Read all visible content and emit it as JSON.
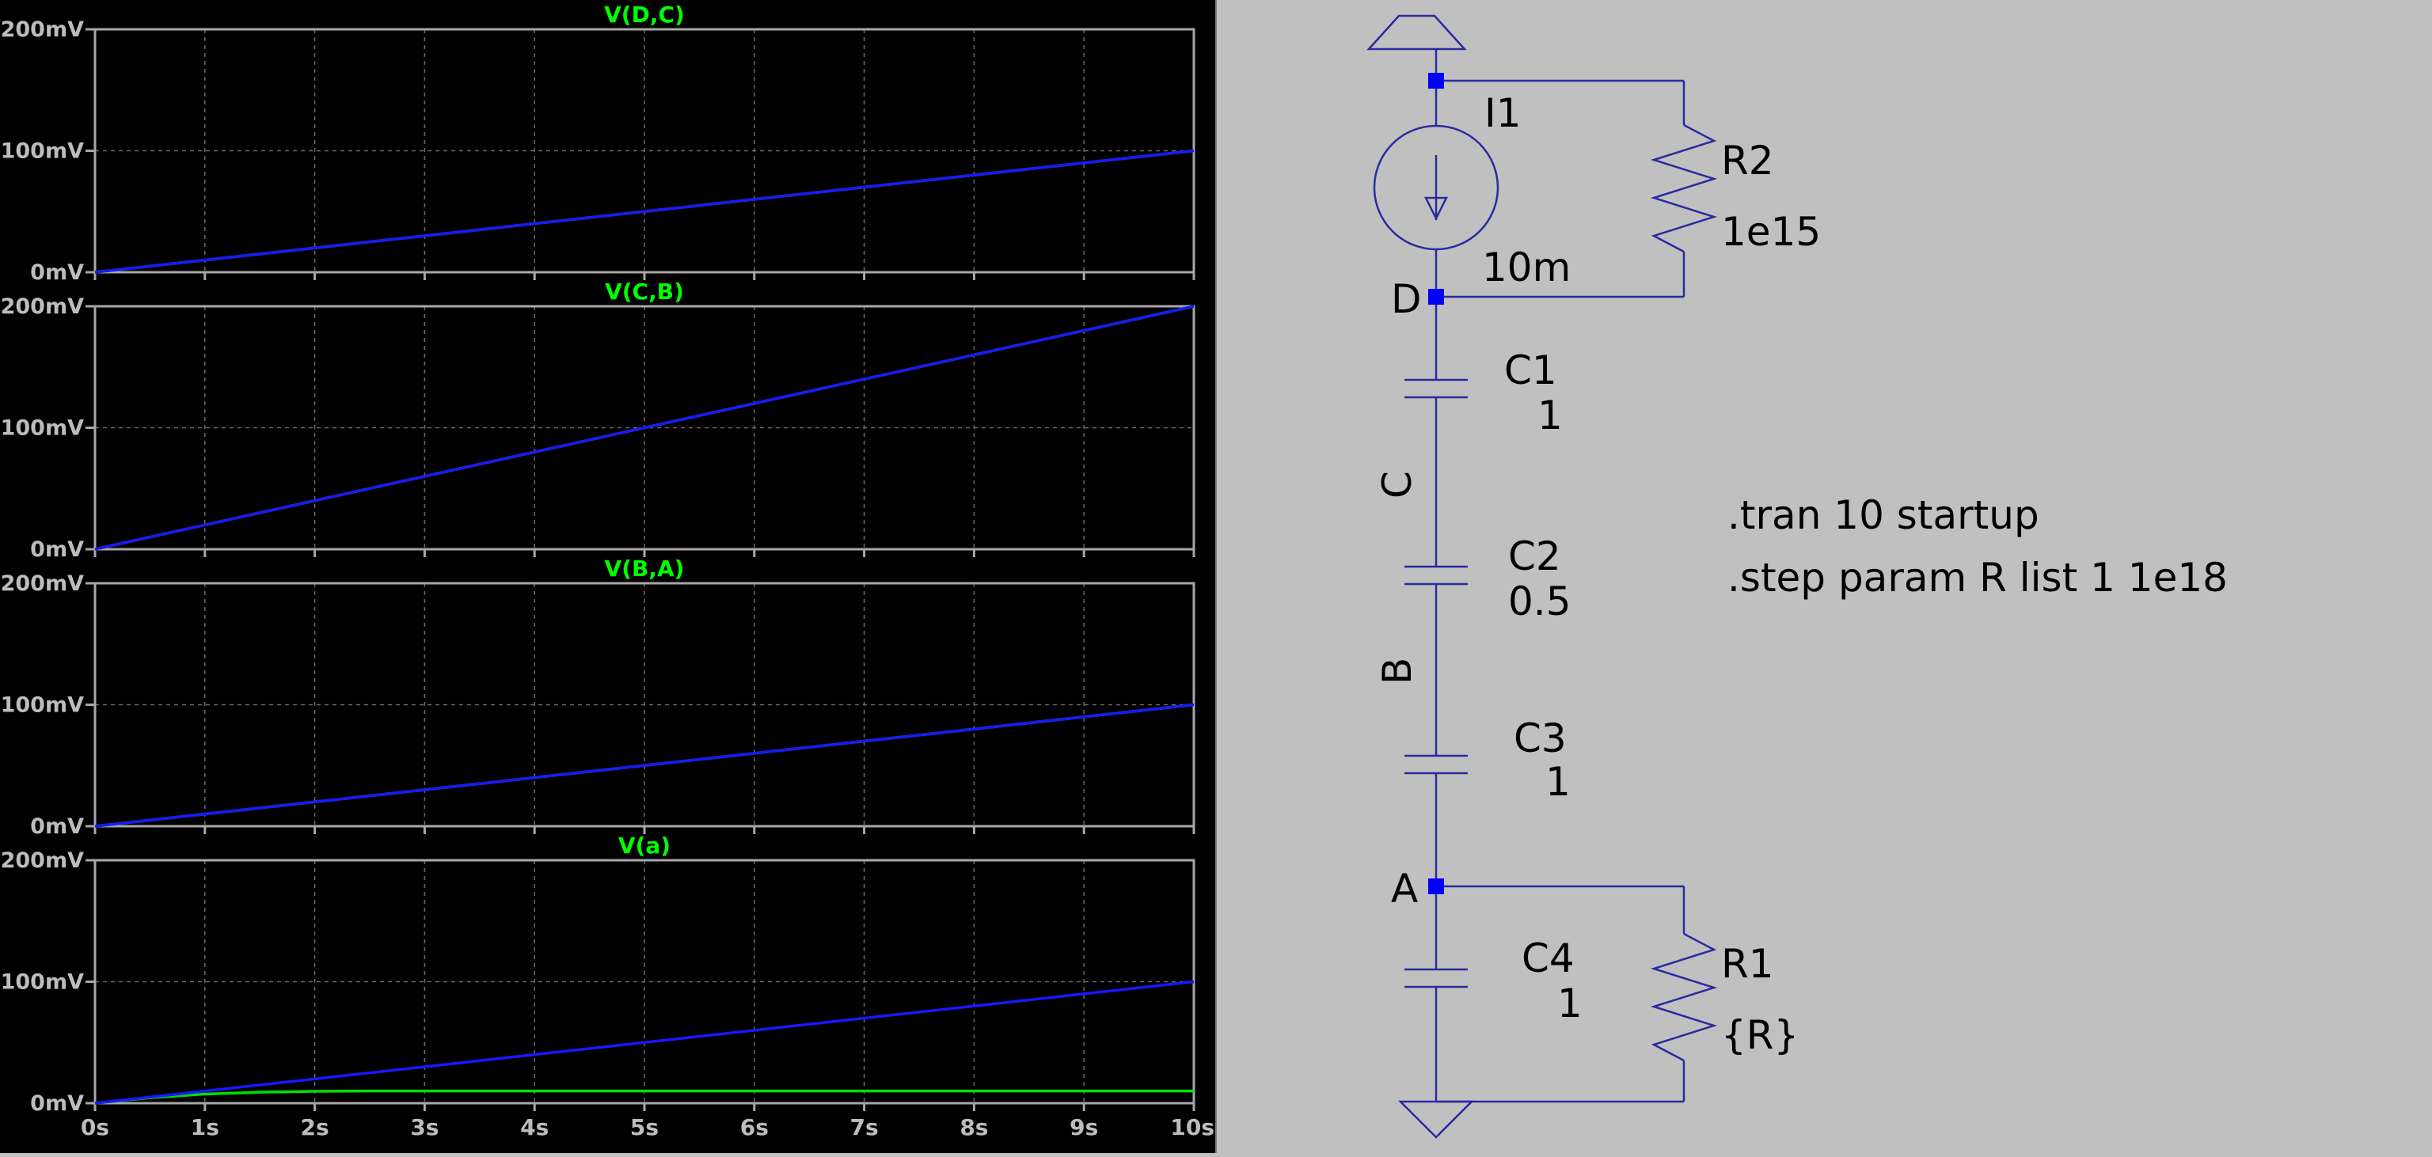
{
  "colors": {
    "plot_background": "#000000",
    "plot_frame": "#a8a8a8",
    "grid": "#6a6a6a",
    "axis_text": "#bdbdbd",
    "trace_title": "#00ff00",
    "trace_blue": "#1818ff",
    "trace_green": "#00e000",
    "schematic_background": "#c0c0c0",
    "schematic_wire": "#2a2aa0",
    "schematic_node": "#0000ff",
    "schematic_text": "#000000"
  },
  "plot": {
    "x_tick_labels": [
      "0s",
      "1s",
      "2s",
      "3s",
      "4s",
      "5s",
      "6s",
      "7s",
      "8s",
      "9s",
      "10s"
    ],
    "y_tick_labels": [
      "0mV",
      "100mV",
      "200mV"
    ]
  },
  "chart_data": [
    {
      "type": "line",
      "title": "V(D,C)",
      "xlabel": "",
      "ylabel": "",
      "xlim": [
        0,
        10
      ],
      "ylim": [
        0,
        200
      ],
      "grid": true,
      "series": [
        {
          "color": "#1818ff",
          "x": [
            0,
            10
          ],
          "y": [
            0,
            100
          ]
        },
        {
          "color": "#00e000",
          "x": [
            0,
            10
          ],
          "y": [
            0,
            100
          ]
        }
      ]
    },
    {
      "type": "line",
      "title": "V(C,B)",
      "xlabel": "",
      "ylabel": "",
      "xlim": [
        0,
        10
      ],
      "ylim": [
        0,
        200
      ],
      "grid": true,
      "series": [
        {
          "color": "#1818ff",
          "x": [
            0,
            10
          ],
          "y": [
            0,
            200
          ]
        },
        {
          "color": "#00e000",
          "x": [
            0,
            10
          ],
          "y": [
            0,
            200
          ]
        }
      ]
    },
    {
      "type": "line",
      "title": "V(B,A)",
      "xlabel": "",
      "ylabel": "",
      "xlim": [
        0,
        10
      ],
      "ylim": [
        0,
        200
      ],
      "grid": true,
      "series": [
        {
          "color": "#1818ff",
          "x": [
            0,
            10
          ],
          "y": [
            0,
            100
          ]
        },
        {
          "color": "#00e000",
          "x": [
            0,
            10
          ],
          "y": [
            0,
            100
          ]
        }
      ]
    },
    {
      "type": "line",
      "title": "V(a)",
      "xlabel": "",
      "ylabel": "",
      "xlim": [
        0,
        10
      ],
      "ylim": [
        0,
        200
      ],
      "grid": true,
      "series": [
        {
          "color": "#1818ff",
          "x": [
            0,
            10
          ],
          "y": [
            0,
            100
          ]
        },
        {
          "color": "#00e000",
          "x": [
            0,
            0.5,
            1,
            1.5,
            2,
            2.5,
            3,
            5,
            10
          ],
          "y": [
            0,
            4.5,
            7.5,
            9,
            9.8,
            10,
            10,
            10,
            10
          ]
        }
      ]
    }
  ],
  "schematic": {
    "components": {
      "i1_name": "I1",
      "i1_value": "10m",
      "r2_name": "R2",
      "r2_value": "1e15",
      "c1_name": "C1",
      "c1_value": "1",
      "c2_name": "C2",
      "c2_value": "0.5",
      "c3_name": "C3",
      "c3_value": "1",
      "c4_name": "C4",
      "c4_value": "1",
      "r1_name": "R1",
      "r1_value": "{R}"
    },
    "nodes": {
      "d": "D",
      "c": "C",
      "b": "B",
      "a": "A"
    },
    "directives": [
      ".tran 10 startup",
      ".step param R list 1 1e18"
    ]
  }
}
